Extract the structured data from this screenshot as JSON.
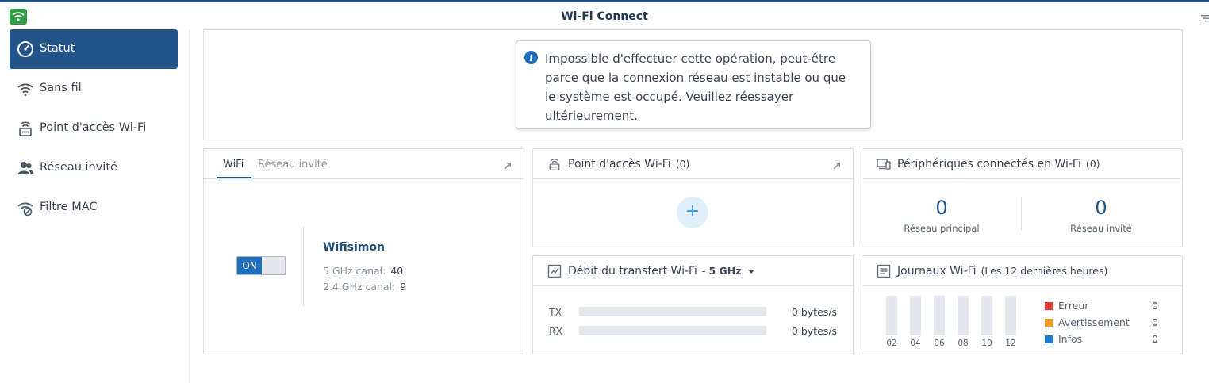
{
  "app": {
    "title": "Wi-Fi Connect"
  },
  "sidebar": {
    "items": [
      {
        "label": "Statut",
        "icon": "gauge-icon",
        "active": true
      },
      {
        "label": "Sans fil",
        "icon": "wifi-icon"
      },
      {
        "label": "Point d'accès Wi-Fi",
        "icon": "access-point-icon"
      },
      {
        "label": "Réseau invité",
        "icon": "guest-users-icon"
      },
      {
        "label": "Filtre MAC",
        "icon": "wifi-filter-icon"
      }
    ]
  },
  "notice": {
    "icon": "info-icon",
    "text": "Impossible d'effectuer cette opération, peut-être parce que la connexion réseau est instable ou que le système est occupé. Veuillez réessayer ultérieurement."
  },
  "wifi_panel": {
    "tabs": [
      "WiFi",
      "Réseau invité"
    ],
    "active_tab": "WiFi",
    "toggle_label": "ON",
    "ssid": "Wifisimon",
    "channels": [
      {
        "label": "5 GHz canal:",
        "value": "40"
      },
      {
        "label": "2.4 GHz canal:",
        "value": "9"
      }
    ]
  },
  "ap_panel": {
    "title": "Point d'accès Wi-Fi",
    "count": "(0)",
    "add_label": "+"
  },
  "devices_panel": {
    "title": "Périphériques connectés en Wi-Fi",
    "count": "(0)",
    "stats": [
      {
        "value": "0",
        "label": "Réseau principal"
      },
      {
        "value": "0",
        "label": "Réseau invité"
      }
    ]
  },
  "throughput_panel": {
    "title": "Débit du transfert Wi-Fi",
    "band": "5 GHz",
    "rows": [
      {
        "label": "TX",
        "value": "0 bytes/s",
        "fill": 0
      },
      {
        "label": "RX",
        "value": "0 bytes/s",
        "fill": 0
      }
    ]
  },
  "logs_panel": {
    "title": "Journaux Wi-Fi",
    "subtitle": "(Les 12 dernières heures)",
    "hours": [
      "02",
      "04",
      "06",
      "08",
      "10",
      "12"
    ],
    "legend": [
      {
        "label": "Erreur",
        "value": "0",
        "color": "#e53935"
      },
      {
        "label": "Avertissement",
        "value": "0",
        "color": "#f39a1f"
      },
      {
        "label": "Infos",
        "value": "0",
        "color": "#1d7fd0"
      }
    ]
  },
  "colors": {
    "primary": "#22548a",
    "accent": "#1d6fc1"
  }
}
